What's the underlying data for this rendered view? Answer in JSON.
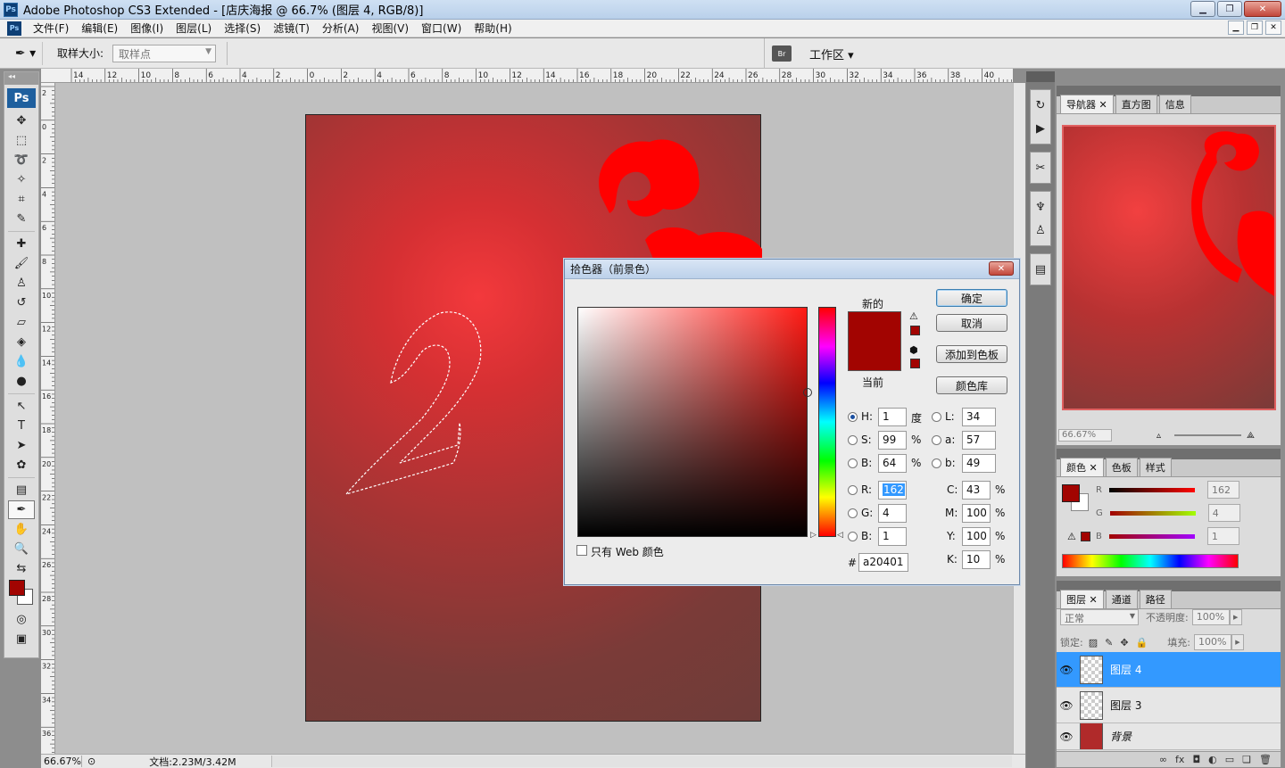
{
  "window": {
    "title": "Adobe Photoshop CS3 Extended - [店庆海报 @ 66.7% (图层 4, RGB/8)]",
    "app_badge": "Ps"
  },
  "menu": [
    "文件(F)",
    "编辑(E)",
    "图像(I)",
    "图层(L)",
    "选择(S)",
    "滤镜(T)",
    "分析(A)",
    "视图(V)",
    "窗口(W)",
    "帮助(H)"
  ],
  "options_bar": {
    "sample_size_label": "取样大小:",
    "sample_size_value": "取样点",
    "bridge_label": "Br",
    "workspace_label": "工作区 ▾"
  },
  "toolbox": {
    "logo": "Ps"
  },
  "rulers": {
    "h_ticks": [
      "14",
      "12",
      "10",
      "8",
      "6",
      "4",
      "2",
      "0",
      "2",
      "4",
      "6",
      "8",
      "10",
      "12",
      "14",
      "16",
      "18",
      "20",
      "22",
      "24",
      "26",
      "28",
      "30",
      "32",
      "34",
      "36",
      "38",
      "40"
    ],
    "v_ticks": [
      "2",
      "0",
      "2",
      "4",
      "6",
      "8",
      "10",
      "12",
      "14",
      "16",
      "18",
      "20",
      "22",
      "24",
      "26",
      "28",
      "30",
      "32",
      "34",
      "36"
    ]
  },
  "status": {
    "zoom": "66.67%",
    "doc_size": "文档:2.23M/3.42M"
  },
  "color_picker": {
    "title": "拾色器（前景色）",
    "new_label": "新的",
    "current_label": "当前",
    "ok": "确定",
    "cancel": "取消",
    "add_to_swatches": "添加到色板",
    "color_libraries": "颜色库",
    "web_only": "只有 Web 颜色",
    "fields": {
      "H": "1",
      "S": "99",
      "B": "64",
      "R": "162",
      "G": "4",
      "Bv": "1",
      "L": "34",
      "a": "57",
      "b": "49",
      "C": "43",
      "M": "100",
      "Y": "100",
      "K": "10",
      "hex": "a20401"
    },
    "labels": {
      "H": "H:",
      "S": "S:",
      "B": "B:",
      "R": "R:",
      "G": "G:",
      "Bv": "B:",
      "L": "L:",
      "a": "a:",
      "b": "b:",
      "C": "C:",
      "M": "M:",
      "Y": "Y:",
      "K": "K:",
      "hash": "#"
    },
    "units": {
      "deg": "度",
      "pct": "%"
    },
    "current_color": "#a20401"
  },
  "navigator": {
    "tabs": [
      "导航器",
      "直方图",
      "信息"
    ],
    "zoom": "66.67%"
  },
  "color_panel": {
    "tabs": [
      "颜色",
      "色板",
      "样式"
    ],
    "R_label": "R",
    "G_label": "G",
    "B_label": "B",
    "R": "162",
    "G": "4",
    "B": "1"
  },
  "layers": {
    "tabs": [
      "图层",
      "通道",
      "路径"
    ],
    "blend_mode": "正常",
    "opacity_label": "不透明度:",
    "opacity": "100%",
    "lock_label": "锁定:",
    "fill_label": "填充:",
    "fill": "100%",
    "items": [
      {
        "name": "图层 4",
        "selected": true
      },
      {
        "name": "图层 3",
        "selected": false
      },
      {
        "name": "背景",
        "selected": false
      }
    ]
  }
}
